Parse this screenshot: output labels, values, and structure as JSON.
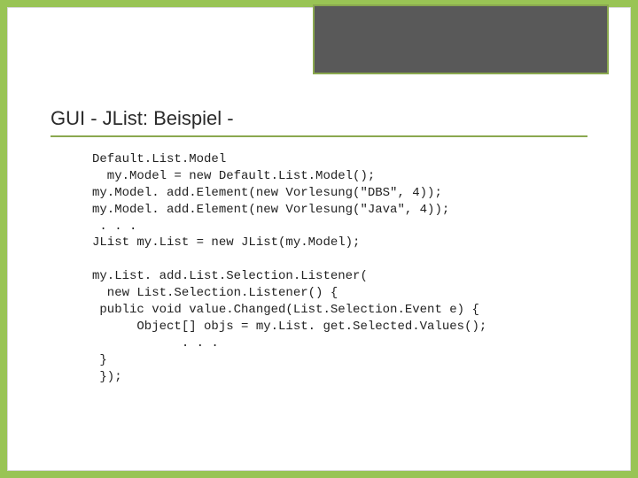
{
  "title": "GUI - JList: Beispiel -",
  "code_lines": [
    "Default.List.Model",
    "  my.Model = new Default.List.Model();",
    "my.Model. add.Element(new Vorlesung(\"DBS\", 4));",
    "my.Model. add.Element(new Vorlesung(\"Java\", 4));",
    " . . .",
    "JList my.List = new JList(my.Model);",
    "",
    "my.List. add.List.Selection.Listener(",
    "  new List.Selection.Listener() {",
    " public void value.Changed(List.Selection.Event e) {",
    "      Object[] objs = my.List. get.Selected.Values();",
    "            . . .",
    " }",
    " });"
  ]
}
